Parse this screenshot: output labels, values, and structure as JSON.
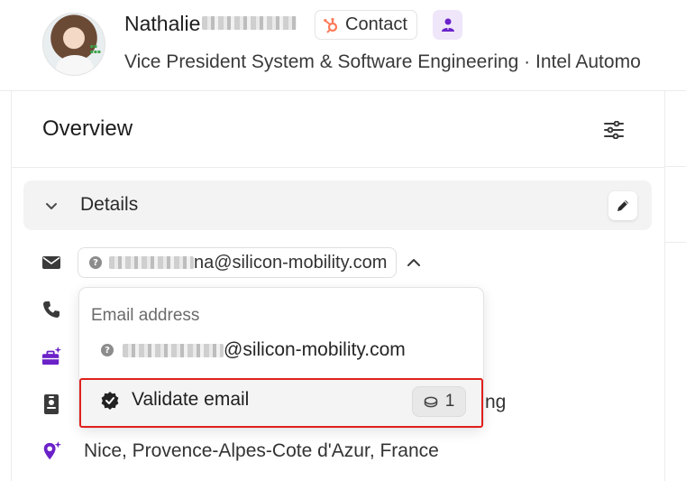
{
  "header": {
    "first_name": "Nathalie",
    "contact_badge_label": "Contact",
    "subtitle": "Vice President System & Software Engineering  ·  Intel Automo"
  },
  "overview": {
    "title": "Overview",
    "section_label": "Details"
  },
  "email": {
    "visible_suffix": "na@silicon-mobility.com"
  },
  "popup": {
    "heading": "Email address",
    "email_suffix": "@silicon-mobility.com",
    "action_label": "Validate email",
    "credit_count": "1"
  },
  "rows": {
    "partial_text": "ng",
    "location": "Nice, Provence-Alpes-Cote d'Azur, France"
  },
  "colors": {
    "hubspot_orange": "#ff7a59",
    "purple_accent": "#6b21c8",
    "highlight_border": "#e0201c",
    "icon_dark": "#3a3a3a"
  },
  "icons": [
    "hubspot-icon",
    "person-icon",
    "filter-sliders-icon",
    "chevron-down-icon",
    "pencil-icon",
    "envelope-icon",
    "chevron-up-icon",
    "phone-icon",
    "briefcase-sparkle-icon",
    "id-card-icon",
    "location-pin-icon",
    "verified-badge-icon",
    "coin-icon",
    "question-icon"
  ]
}
